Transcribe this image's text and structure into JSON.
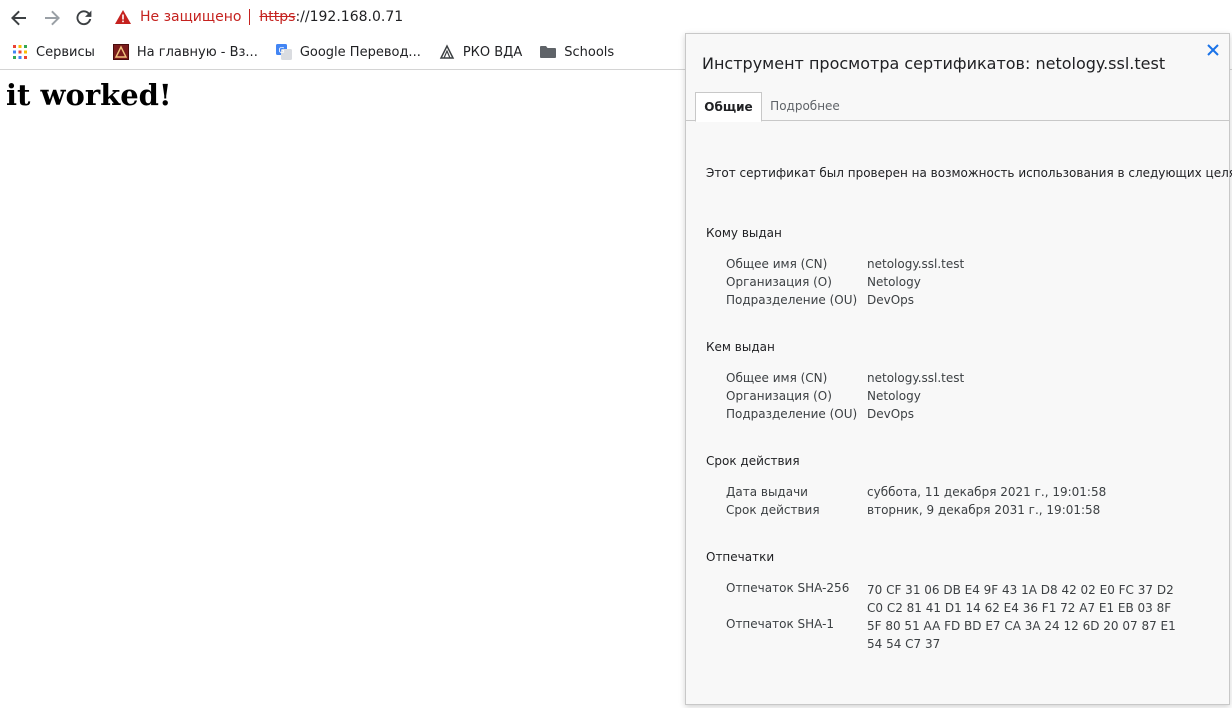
{
  "browser": {
    "security_label": "Не защищено",
    "url_scheme": "https",
    "url_rest": "://192.168.0.71",
    "bookmarks": [
      {
        "label": "Сервисы",
        "icon": "apps-grid-icon"
      },
      {
        "label": "На главную - Вз...",
        "icon": "site-favicon"
      },
      {
        "label": "Google Перевод...",
        "icon": "google-translate-icon"
      },
      {
        "label": "РКО ВДА",
        "icon": "site-favicon"
      },
      {
        "label": "Schools",
        "icon": "folder-icon"
      }
    ]
  },
  "page": {
    "heading": "it worked!"
  },
  "dialog": {
    "title": "Инструмент просмотра сертификатов: netology.ssl.test",
    "tabs": [
      {
        "label": "Общие",
        "active": true
      },
      {
        "label": "Подробнее",
        "active": false
      }
    ],
    "purpose_text": "Этот сертификат был проверен на возможность использования в следующих целях:",
    "issued_to": {
      "title": "Кому выдан",
      "rows": [
        {
          "label": "Общее имя (CN)",
          "value": "netology.ssl.test"
        },
        {
          "label": "Организация (O)",
          "value": "Netology"
        },
        {
          "label": "Подразделение (OU)",
          "value": "DevOps"
        }
      ]
    },
    "issued_by": {
      "title": "Кем выдан",
      "rows": [
        {
          "label": "Общее имя (CN)",
          "value": "netology.ssl.test"
        },
        {
          "label": "Организация (O)",
          "value": "Netology"
        },
        {
          "label": "Подразделение (OU)",
          "value": "DevOps"
        }
      ]
    },
    "validity": {
      "title": "Срок действия",
      "rows": [
        {
          "label": "Дата выдачи",
          "value": "суббота, 11 декабря 2021 г., 19:01:58"
        },
        {
          "label": "Срок действия",
          "value": "вторник, 9 декабря 2031 г., 19:01:58"
        }
      ]
    },
    "fingerprints": {
      "title": "Отпечатки",
      "rows": [
        {
          "label": "Отпечаток SHA-256",
          "line1": "70 CF 31 06 DB E4 9F 43 1A D8 42 02 E0 FC 37 D2",
          "line2": "C0 C2 81 41 D1 14 62 E4 36 F1 72 A7 E1 EB 03 8F"
        },
        {
          "label": "Отпечаток SHA-1",
          "line1": "5F 80 51 AA FD BD E7 CA 3A 24 12 6D 20 07 87 E1",
          "line2": "54 54 C7 37"
        }
      ]
    }
  }
}
